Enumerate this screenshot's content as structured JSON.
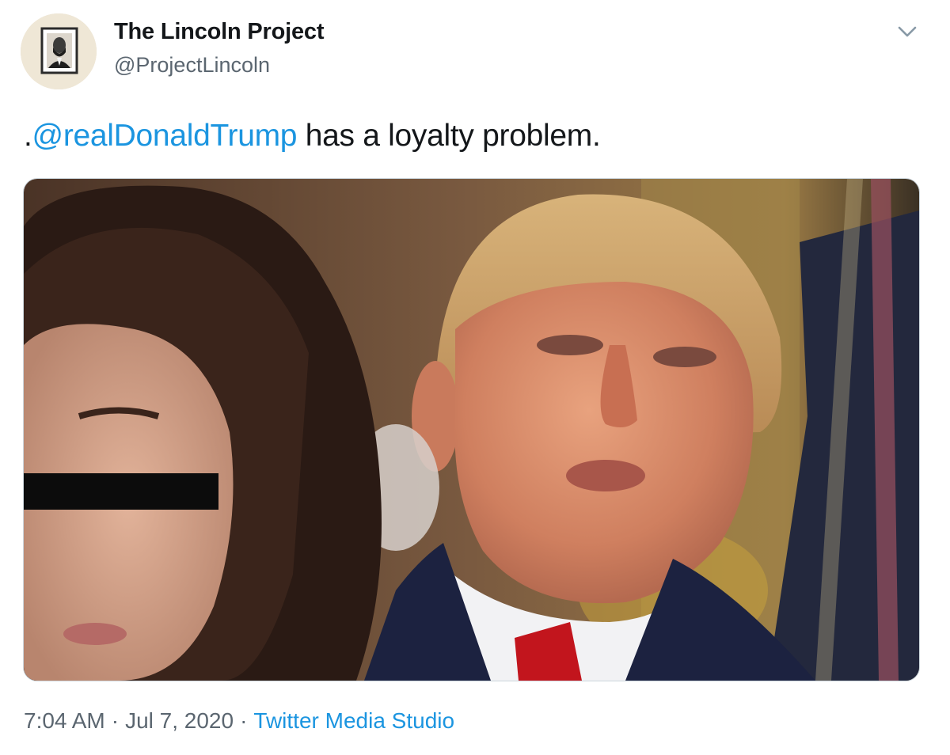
{
  "author": {
    "name": "The Lincoln Project",
    "handle": "@ProjectLincoln"
  },
  "tweet": {
    "text_prefix": ".",
    "mention": "@realDonaldTrump",
    "text_rest": " has a loyalty problem.",
    "time": "7:04 AM",
    "separator": "·",
    "date": "Jul 7, 2020",
    "source": "Twitter Media Studio"
  },
  "icons": {
    "more": "chevron-down-icon",
    "avatar": "lincoln-portrait-avatar"
  },
  "colors": {
    "link": "#1b95e0",
    "text": "#14171a",
    "secondary": "#5b6670"
  }
}
